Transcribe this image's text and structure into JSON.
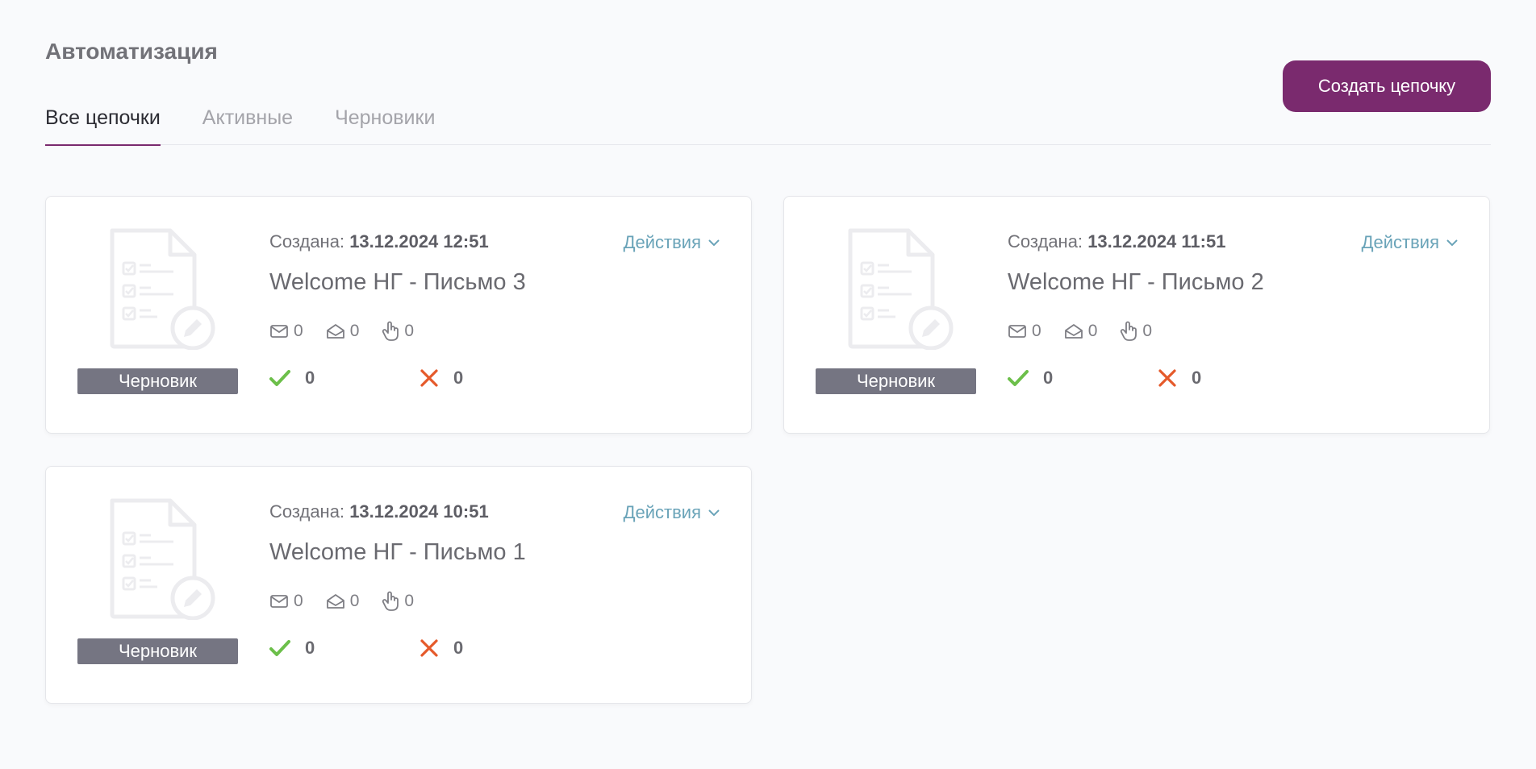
{
  "header": {
    "title": "Автоматизация",
    "create_button": "Создать цепочку"
  },
  "tabs": [
    {
      "label": "Все цепочки",
      "active": true
    },
    {
      "label": "Активные",
      "active": false
    },
    {
      "label": "Черновики",
      "active": false
    }
  ],
  "cards": [
    {
      "created_label": "Создана:",
      "created_at": "13.12.2024 12:51",
      "actions_label": "Действия",
      "title": "Welcome НГ - Письмо 3",
      "status": "Черновик",
      "stats": {
        "sent": "0",
        "opened": "0",
        "clicked": "0"
      },
      "success": "0",
      "failed": "0"
    },
    {
      "created_label": "Создана:",
      "created_at": "13.12.2024 11:51",
      "actions_label": "Действия",
      "title": "Welcome НГ - Письмо 2",
      "status": "Черновик",
      "stats": {
        "sent": "0",
        "opened": "0",
        "clicked": "0"
      },
      "success": "0",
      "failed": "0"
    },
    {
      "created_label": "Создана:",
      "created_at": "13.12.2024 10:51",
      "actions_label": "Действия",
      "title": "Welcome НГ - Письмо 1",
      "status": "Черновик",
      "stats": {
        "sent": "0",
        "opened": "0",
        "clicked": "0"
      },
      "success": "0",
      "failed": "0"
    }
  ],
  "colors": {
    "accent": "#7a2a6e",
    "link": "#69a3b8",
    "success": "#6cbf4a",
    "error": "#e55a2b",
    "badge": "#757582"
  }
}
